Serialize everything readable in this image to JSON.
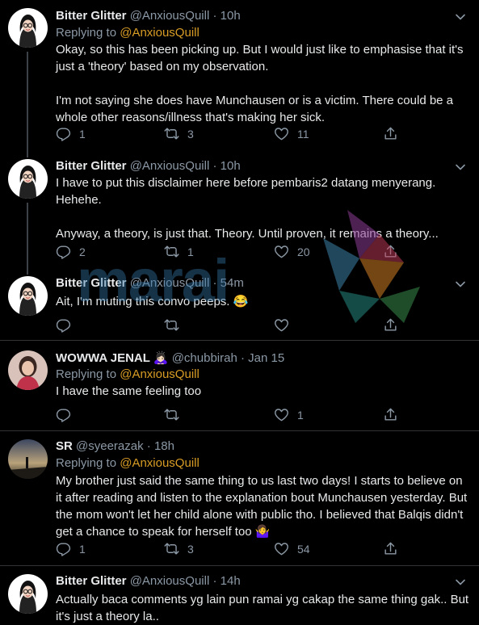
{
  "tweets": [
    {
      "name": "Bitter Glitter",
      "handle": "@AnxiousQuill",
      "time": "10h",
      "replying_prefix": "Replying to",
      "replying_to": "@AnxiousQuill",
      "paragraphs": [
        "Okay, so this has been picking up. But I would just like to emphasise that it's just a 'theory' based on my observation.",
        "I'm not saying she does have Munchausen or is a victim. There could be a whole other reasons/illness that's making her sick."
      ],
      "replies": "1",
      "retweets": "3",
      "likes": "11"
    },
    {
      "name": "Bitter Glitter",
      "handle": "@AnxiousQuill",
      "time": "10h",
      "paragraphs": [
        "I have to put this disclaimer here before pembaris2 datang menyerang. Hehehe.",
        "Anyway, a theory, is just that. Theory. Until proven, it remains a theory..."
      ],
      "replies": "2",
      "retweets": "1",
      "likes": "20"
    },
    {
      "name": "Bitter Glitter",
      "handle": "@AnxiousQuill",
      "time": "54m",
      "paragraphs": [
        "Ait, I'm muting this convo peeps. 😂"
      ],
      "replies": "",
      "retweets": "",
      "likes": ""
    },
    {
      "name": "WOWWA JENAL 🙇🏻‍♀️",
      "handle": "@chubbirah",
      "time": "Jan 15",
      "replying_prefix": "Replying to",
      "replying_to": "@AnxiousQuill",
      "paragraphs": [
        "I have the same feeling too"
      ],
      "replies": "",
      "retweets": "",
      "likes": "1"
    },
    {
      "name": "SR",
      "handle": "@syeerazak",
      "time": "18h",
      "replying_prefix": "Replying to",
      "replying_to": "@AnxiousQuill",
      "paragraphs": [
        "My brother just said the same thing to us last two days! I starts to believe on it after reading and listen to the explanation bout Munchausen yesterday. But the mom won't let her child alone with public tho. I believed that Balqis didn't get a chance to speak for herself too 🤷‍♀️"
      ],
      "replies": "1",
      "retweets": "3",
      "likes": "54"
    },
    {
      "name": "Bitter Glitter",
      "handle": "@AnxiousQuill",
      "time": "14h",
      "paragraphs": [
        "Actually baca comments yg lain pun ramai yg cakap the same thing gak.. But it's just a theory la.."
      ]
    }
  ],
  "separator": "·",
  "watermark": "marai",
  "icons": {
    "reply": "reply-icon",
    "retweet": "retweet-icon",
    "like": "heart-icon",
    "share": "share-icon",
    "more": "chevron-down-icon"
  },
  "colors": {
    "background": "#000000",
    "mention": "#d99d25",
    "secondary_text": "#8b98a5",
    "divider": "#2f3336"
  }
}
